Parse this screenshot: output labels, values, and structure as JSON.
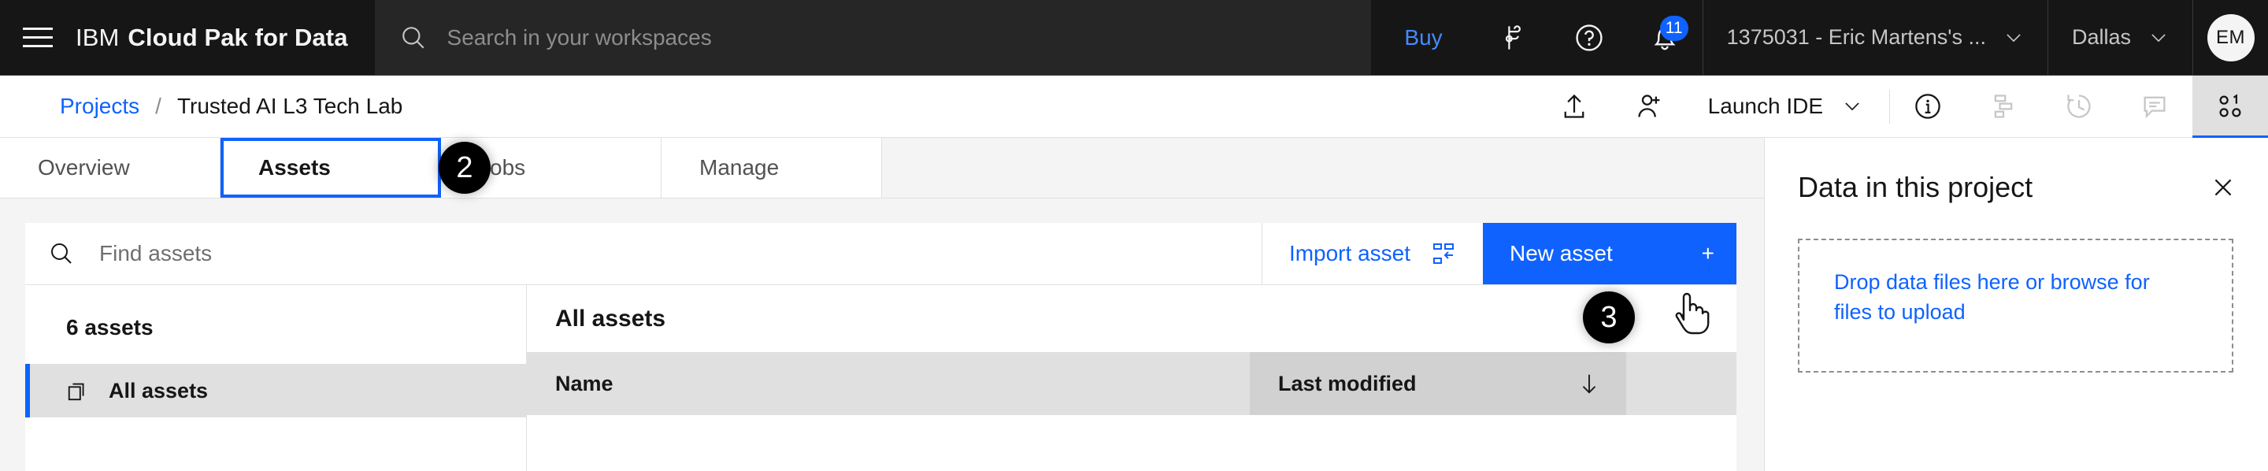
{
  "header": {
    "menu_icon": "hamburger-menu-icon",
    "brand_light": "IBM",
    "brand_bold": "Cloud Pak for Data",
    "search_placeholder": "Search in your workspaces",
    "search_value": "",
    "buy_label": "Buy",
    "notifications_count": "11",
    "account_label": "1375031 - Eric Martens's ...",
    "region_label": "Dallas",
    "avatar_initials": "EM"
  },
  "breadcrumb": {
    "parent": "Projects",
    "separator": "/",
    "current": "Trusted AI L3 Tech Lab",
    "launch_ide_label": "Launch IDE"
  },
  "tabs": [
    {
      "label": "Overview",
      "selected": false
    },
    {
      "label": "Assets",
      "selected": true
    },
    {
      "label": "Jobs",
      "selected": false
    },
    {
      "label": "Manage",
      "selected": false
    }
  ],
  "toolbar": {
    "find_placeholder": "Find assets",
    "find_value": "",
    "import_label": "Import asset",
    "new_asset_label": "New asset",
    "new_asset_plus": "+"
  },
  "left_pane": {
    "assets_count": "6 assets",
    "items": [
      {
        "label": "All assets",
        "selected": true
      }
    ]
  },
  "asset_table": {
    "title": "All assets",
    "columns": [
      {
        "label": "Name",
        "sorted": false
      },
      {
        "label": "Last modified",
        "sorted": true,
        "sort_direction": "descending"
      }
    ],
    "rows": []
  },
  "side_panel": {
    "title": "Data in this project",
    "dropzone_text": "Drop data files here or browse for files to upload"
  },
  "annotations": [
    {
      "id": "2",
      "target": "tab-assets"
    },
    {
      "id": "3",
      "target": "new-asset-button"
    }
  ],
  "colors": {
    "brand_blue": "#0f62fe",
    "link_blue_dark_bg": "#4589ff",
    "header_bg": "#161616",
    "search_bg": "#262626",
    "page_bg": "#f4f4f4",
    "table_header_bg": "#e0e0e0",
    "sorted_column_bg": "#d1d1d1"
  }
}
